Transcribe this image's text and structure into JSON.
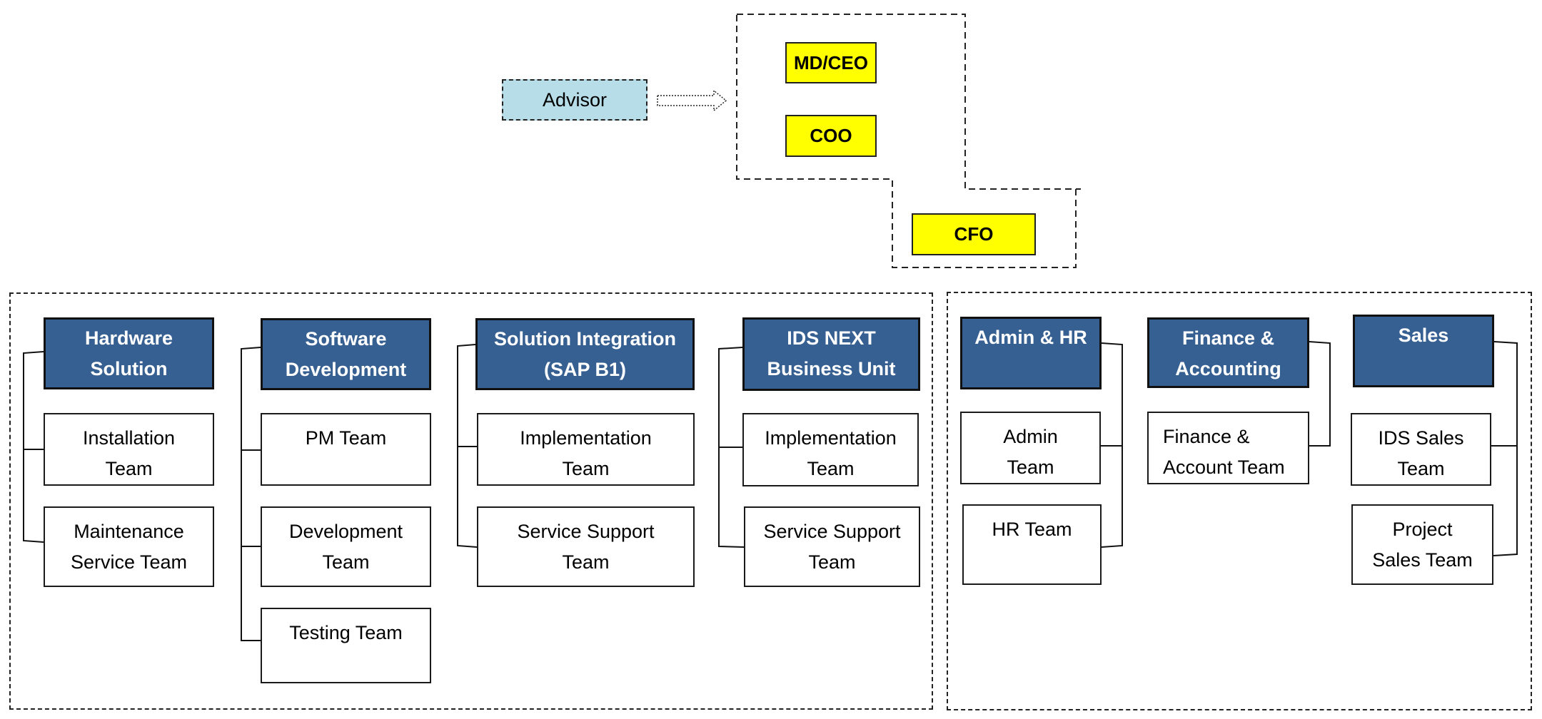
{
  "advisor": {
    "label": "Advisor"
  },
  "executives": {
    "md_ceo": "MD/CEO",
    "coo": "COO",
    "cfo": "CFO"
  },
  "departments": [
    {
      "name": "Hardware\nSolution",
      "teams": [
        "Installation\nTeam",
        "Maintenance\nService Team"
      ]
    },
    {
      "name": "Software\nDevelopment",
      "teams": [
        "PM Team",
        "Development\nTeam",
        "Testing Team"
      ]
    },
    {
      "name": "Solution Integration\n(SAP B1)",
      "teams": [
        "Implementation\nTeam",
        "Service Support\nTeam"
      ]
    },
    {
      "name": "IDS NEXT\nBusiness Unit",
      "teams": [
        "Implementation\nTeam",
        "Service Support\nTeam"
      ]
    },
    {
      "name": "Admin & HR",
      "teams": [
        "Admin\nTeam",
        "HR Team"
      ]
    },
    {
      "name": "Finance &\nAccounting",
      "teams": [
        "Finance &\nAccount Team"
      ]
    },
    {
      "name": "Sales",
      "teams": [
        "IDS Sales\nTeam",
        "Project\nSales Team"
      ]
    }
  ],
  "colors": {
    "department_header": "#376092",
    "executive": "#ffff00",
    "advisor": "#b7dde8"
  }
}
